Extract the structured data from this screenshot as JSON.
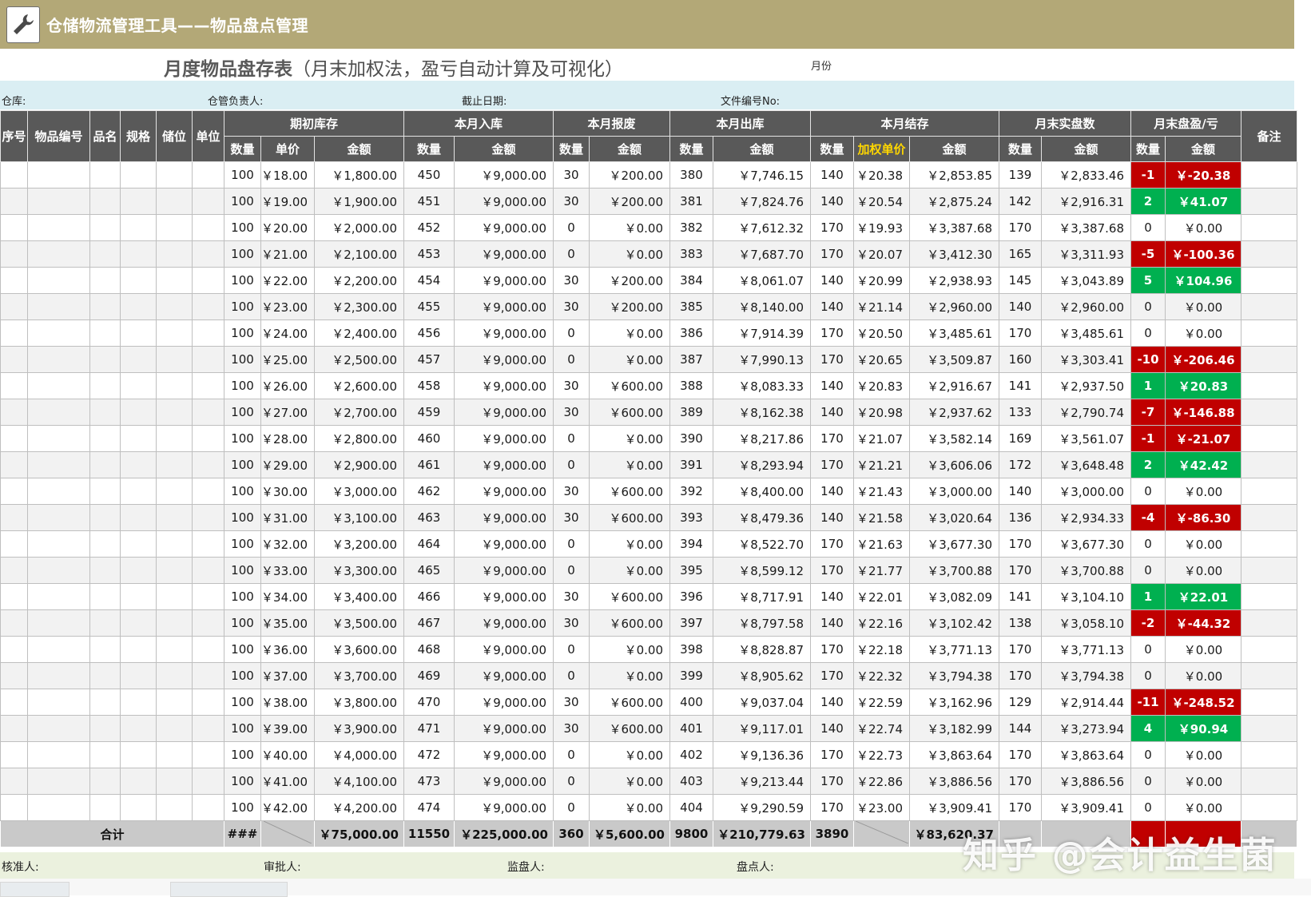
{
  "app": {
    "title": "仓储物流管理工具——物品盘点管理"
  },
  "sheet": {
    "title_main": "月度物品盘存表",
    "title_sub": "（月末加权法，盈亏自动计算及可视化）",
    "month_label": "月份"
  },
  "info": {
    "warehouse": "仓库:",
    "keeper": "仓管负责人:",
    "deadline": "截止日期:",
    "docno": "文件编号No:"
  },
  "headers": {
    "seq": "序号",
    "code": "物品编号",
    "name": "品名",
    "spec": "规格",
    "loc": "储位",
    "unit": "单位",
    "opening": "期初库存",
    "inbound": "本月入库",
    "scrap": "本月报废",
    "outbound": "本月出库",
    "ending": "本月结存",
    "actual": "月末实盘数",
    "diff": "月末盘盈/亏",
    "remark": "备注",
    "qty": "数量",
    "unit_price": "单价",
    "amount": "金额",
    "weighted_price": "加权单价"
  },
  "rows": [
    [
      "100",
      "￥18.00",
      "￥1,800.00",
      "450",
      "￥9,000.00",
      "30",
      "￥200.00",
      "380",
      "￥7,746.15",
      "140",
      "￥20.38",
      "￥2,853.85",
      "139",
      "￥2,833.46",
      "-1",
      "￥-20.38"
    ],
    [
      "100",
      "￥19.00",
      "￥1,900.00",
      "451",
      "￥9,000.00",
      "30",
      "￥200.00",
      "381",
      "￥7,824.76",
      "140",
      "￥20.54",
      "￥2,875.24",
      "142",
      "￥2,916.31",
      "2",
      "￥41.07"
    ],
    [
      "100",
      "￥20.00",
      "￥2,000.00",
      "452",
      "￥9,000.00",
      "0",
      "￥0.00",
      "382",
      "￥7,612.32",
      "170",
      "￥19.93",
      "￥3,387.68",
      "170",
      "￥3,387.68",
      "0",
      "￥0.00"
    ],
    [
      "100",
      "￥21.00",
      "￥2,100.00",
      "453",
      "￥9,000.00",
      "0",
      "￥0.00",
      "383",
      "￥7,687.70",
      "170",
      "￥20.07",
      "￥3,412.30",
      "165",
      "￥3,311.93",
      "-5",
      "￥-100.36"
    ],
    [
      "100",
      "￥22.00",
      "￥2,200.00",
      "454",
      "￥9,000.00",
      "30",
      "￥200.00",
      "384",
      "￥8,061.07",
      "140",
      "￥20.99",
      "￥2,938.93",
      "145",
      "￥3,043.89",
      "5",
      "￥104.96"
    ],
    [
      "100",
      "￥23.00",
      "￥2,300.00",
      "455",
      "￥9,000.00",
      "30",
      "￥200.00",
      "385",
      "￥8,140.00",
      "140",
      "￥21.14",
      "￥2,960.00",
      "140",
      "￥2,960.00",
      "0",
      "￥0.00"
    ],
    [
      "100",
      "￥24.00",
      "￥2,400.00",
      "456",
      "￥9,000.00",
      "0",
      "￥0.00",
      "386",
      "￥7,914.39",
      "170",
      "￥20.50",
      "￥3,485.61",
      "170",
      "￥3,485.61",
      "0",
      "￥0.00"
    ],
    [
      "100",
      "￥25.00",
      "￥2,500.00",
      "457",
      "￥9,000.00",
      "0",
      "￥0.00",
      "387",
      "￥7,990.13",
      "170",
      "￥20.65",
      "￥3,509.87",
      "160",
      "￥3,303.41",
      "-10",
      "￥-206.46"
    ],
    [
      "100",
      "￥26.00",
      "￥2,600.00",
      "458",
      "￥9,000.00",
      "30",
      "￥600.00",
      "388",
      "￥8,083.33",
      "140",
      "￥20.83",
      "￥2,916.67",
      "141",
      "￥2,937.50",
      "1",
      "￥20.83"
    ],
    [
      "100",
      "￥27.00",
      "￥2,700.00",
      "459",
      "￥9,000.00",
      "30",
      "￥600.00",
      "389",
      "￥8,162.38",
      "140",
      "￥20.98",
      "￥2,937.62",
      "133",
      "￥2,790.74",
      "-7",
      "￥-146.88"
    ],
    [
      "100",
      "￥28.00",
      "￥2,800.00",
      "460",
      "￥9,000.00",
      "0",
      "￥0.00",
      "390",
      "￥8,217.86",
      "170",
      "￥21.07",
      "￥3,582.14",
      "169",
      "￥3,561.07",
      "-1",
      "￥-21.07"
    ],
    [
      "100",
      "￥29.00",
      "￥2,900.00",
      "461",
      "￥9,000.00",
      "0",
      "￥0.00",
      "391",
      "￥8,293.94",
      "170",
      "￥21.21",
      "￥3,606.06",
      "172",
      "￥3,648.48",
      "2",
      "￥42.42"
    ],
    [
      "100",
      "￥30.00",
      "￥3,000.00",
      "462",
      "￥9,000.00",
      "30",
      "￥600.00",
      "392",
      "￥8,400.00",
      "140",
      "￥21.43",
      "￥3,000.00",
      "140",
      "￥3,000.00",
      "0",
      "￥0.00"
    ],
    [
      "100",
      "￥31.00",
      "￥3,100.00",
      "463",
      "￥9,000.00",
      "30",
      "￥600.00",
      "393",
      "￥8,479.36",
      "140",
      "￥21.58",
      "￥3,020.64",
      "136",
      "￥2,934.33",
      "-4",
      "￥-86.30"
    ],
    [
      "100",
      "￥32.00",
      "￥3,200.00",
      "464",
      "￥9,000.00",
      "0",
      "￥0.00",
      "394",
      "￥8,522.70",
      "170",
      "￥21.63",
      "￥3,677.30",
      "170",
      "￥3,677.30",
      "0",
      "￥0.00"
    ],
    [
      "100",
      "￥33.00",
      "￥3,300.00",
      "465",
      "￥9,000.00",
      "0",
      "￥0.00",
      "395",
      "￥8,599.12",
      "170",
      "￥21.77",
      "￥3,700.88",
      "170",
      "￥3,700.88",
      "0",
      "￥0.00"
    ],
    [
      "100",
      "￥34.00",
      "￥3,400.00",
      "466",
      "￥9,000.00",
      "30",
      "￥600.00",
      "396",
      "￥8,717.91",
      "140",
      "￥22.01",
      "￥3,082.09",
      "141",
      "￥3,104.10",
      "1",
      "￥22.01"
    ],
    [
      "100",
      "￥35.00",
      "￥3,500.00",
      "467",
      "￥9,000.00",
      "30",
      "￥600.00",
      "397",
      "￥8,797.58",
      "140",
      "￥22.16",
      "￥3,102.42",
      "138",
      "￥3,058.10",
      "-2",
      "￥-44.32"
    ],
    [
      "100",
      "￥36.00",
      "￥3,600.00",
      "468",
      "￥9,000.00",
      "0",
      "￥0.00",
      "398",
      "￥8,828.87",
      "170",
      "￥22.18",
      "￥3,771.13",
      "170",
      "￥3,771.13",
      "0",
      "￥0.00"
    ],
    [
      "100",
      "￥37.00",
      "￥3,700.00",
      "469",
      "￥9,000.00",
      "0",
      "￥0.00",
      "399",
      "￥8,905.62",
      "170",
      "￥22.32",
      "￥3,794.38",
      "170",
      "￥3,794.38",
      "0",
      "￥0.00"
    ],
    [
      "100",
      "￥38.00",
      "￥3,800.00",
      "470",
      "￥9,000.00",
      "30",
      "￥600.00",
      "400",
      "￥9,037.04",
      "140",
      "￥22.59",
      "￥3,162.96",
      "129",
      "￥2,914.44",
      "-11",
      "￥-248.52"
    ],
    [
      "100",
      "￥39.00",
      "￥3,900.00",
      "471",
      "￥9,000.00",
      "30",
      "￥600.00",
      "401",
      "￥9,117.01",
      "140",
      "￥22.74",
      "￥3,182.99",
      "144",
      "￥3,273.94",
      "4",
      "￥90.94"
    ],
    [
      "100",
      "￥40.00",
      "￥4,000.00",
      "472",
      "￥9,000.00",
      "0",
      "￥0.00",
      "402",
      "￥9,136.36",
      "170",
      "￥22.73",
      "￥3,863.64",
      "170",
      "￥3,863.64",
      "0",
      "￥0.00"
    ],
    [
      "100",
      "￥41.00",
      "￥4,100.00",
      "473",
      "￥9,000.00",
      "0",
      "￥0.00",
      "403",
      "￥9,213.44",
      "170",
      "￥22.86",
      "￥3,886.56",
      "170",
      "￥3,886.56",
      "0",
      "￥0.00"
    ],
    [
      "100",
      "￥42.00",
      "￥4,200.00",
      "474",
      "￥9,000.00",
      "0",
      "￥0.00",
      "404",
      "￥9,290.59",
      "170",
      "￥23.00",
      "￥3,909.41",
      "170",
      "￥3,909.41",
      "0",
      "￥0.00"
    ]
  ],
  "totals": {
    "label": "合计",
    "opening_qty": "###",
    "opening_amount": "￥75,000.00",
    "inbound_qty": "11550",
    "inbound_amount": "￥225,000.00",
    "scrap_qty": "360",
    "scrap_amount": "￥5,600.00",
    "outbound_qty": "9800",
    "outbound_amount": "￥210,779.63",
    "ending_qty": "3890",
    "ending_amount": "￥83,620.37"
  },
  "signatures": {
    "approver": "核准人:",
    "reviewer": "审批人:",
    "supervisor": "监盘人:",
    "counter": "盘点人:"
  },
  "watermark": "知乎 @会计益生菌",
  "colors": {
    "titlebar": "#b3a877",
    "header_bg": "#595959",
    "info_bar": "#daeef3",
    "sign_bar": "#ebf1de",
    "loss": "#c00000",
    "gain": "#00b050",
    "weighted_price_header": "#ffd700"
  },
  "icons": {
    "app": "wrench-icon"
  }
}
